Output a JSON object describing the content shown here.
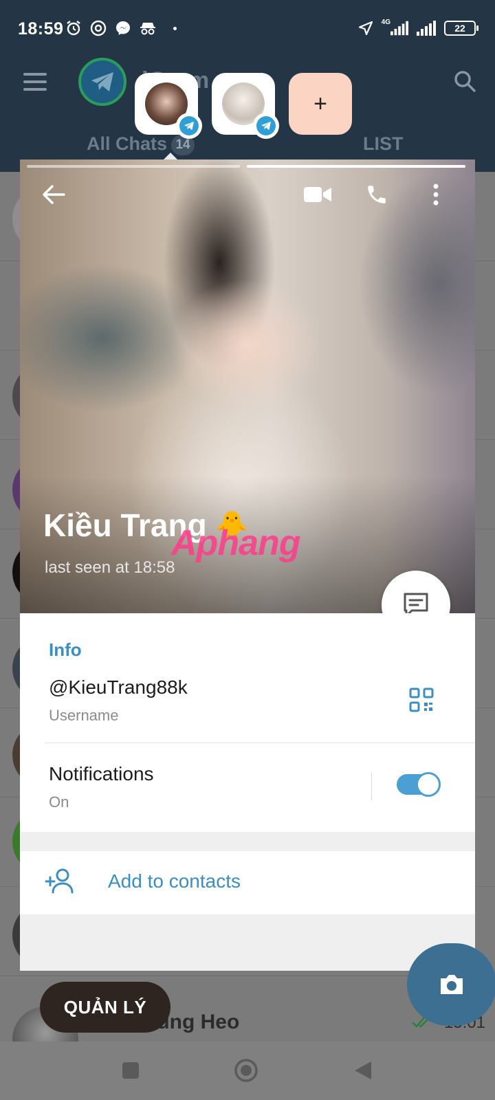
{
  "status_bar": {
    "time": "18:59",
    "network": "4G",
    "battery": "22"
  },
  "app": {
    "title": "iGram",
    "tabs": [
      {
        "label": "All Chats",
        "badge": "14"
      },
      {
        "label": "LIST"
      }
    ]
  },
  "stories": {
    "add_label": "+"
  },
  "profile": {
    "name": "Kiều Trang",
    "emoji": "🐥",
    "watermark": "Aphang",
    "last_seen": "last seen at 18:58",
    "info_title": "Info",
    "username": "@KieuTrang88k",
    "username_label": "Username",
    "notifications_label": "Notifications",
    "notifications_value": "On",
    "add_contacts_label": "Add to contacts"
  },
  "background": {
    "bottom_chat_name": "Tùng Heo",
    "bottom_chat_time": "15:01",
    "manage_label": "QUẢN LÝ"
  },
  "colors": {
    "accent": "#3b8ec2",
    "toggle_on": "#4ba0d3",
    "header": "#243546"
  }
}
